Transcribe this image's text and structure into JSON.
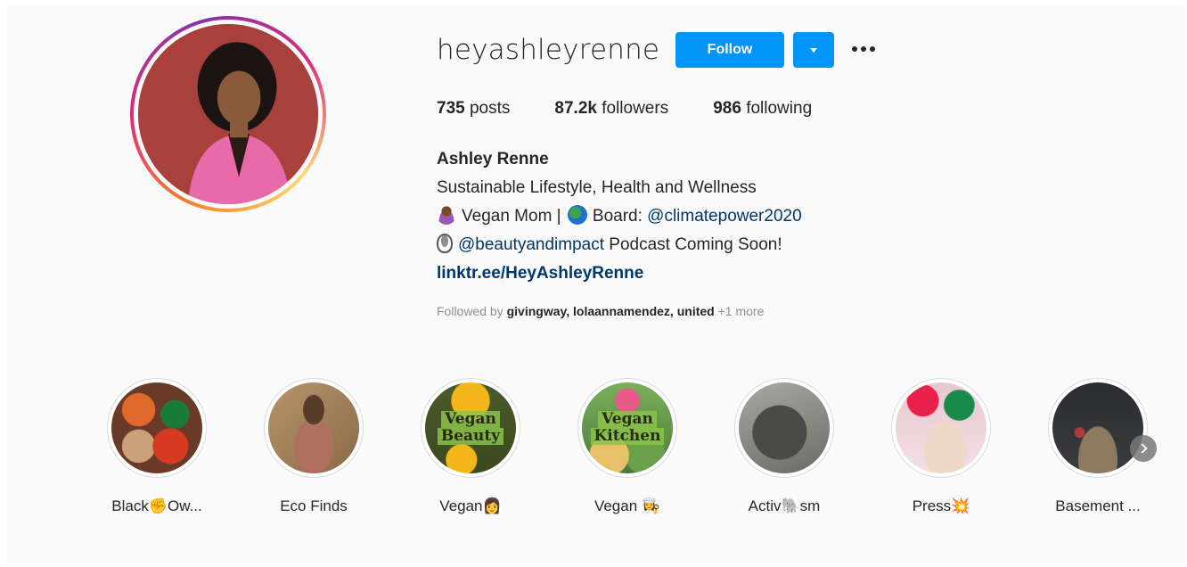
{
  "profile": {
    "username": "heyashleyrenne",
    "follow_label": "Follow",
    "stats": {
      "posts_count": "735",
      "posts_label": "posts",
      "followers_count": "87.2k",
      "followers_label": "followers",
      "following_count": "986",
      "following_label": "following"
    },
    "bio": {
      "name": "Ashley Renne",
      "line1": "Sustainable Lifestyle, Health and Wellness",
      "line2_text_a": "Vegan Mom |",
      "line2_text_b": "Board:",
      "line2_mention": "@climatepower2020",
      "line3_mention": "@beautyandimpact",
      "line3_text": "Podcast Coming Soon!",
      "link": "linktr.ee/HeyAshleyRenne"
    },
    "followed_by": {
      "prefix": "Followed by",
      "names": "givingway, lolaannamendez, united",
      "more": "+1 more"
    }
  },
  "highlights": [
    {
      "label": "Black✊Ow..."
    },
    {
      "label": "Eco Finds"
    },
    {
      "label": "Vegan👩",
      "overlay": [
        "Vegan",
        "Beauty"
      ]
    },
    {
      "label": "Vegan 👩‍🍳",
      "overlay": [
        "Vegan",
        "Kitchen"
      ]
    },
    {
      "label": "Activ🐘sm"
    },
    {
      "label": "Press💥"
    },
    {
      "label": "Basement ..."
    }
  ],
  "colors": {
    "accent": "#0095f6",
    "link": "#00376b",
    "muted": "#8e8e8e",
    "text": "#262626"
  },
  "icons": {
    "dropdown": "chevron-down-icon",
    "more": "more-horizontal-icon",
    "next": "chevron-right-icon"
  }
}
